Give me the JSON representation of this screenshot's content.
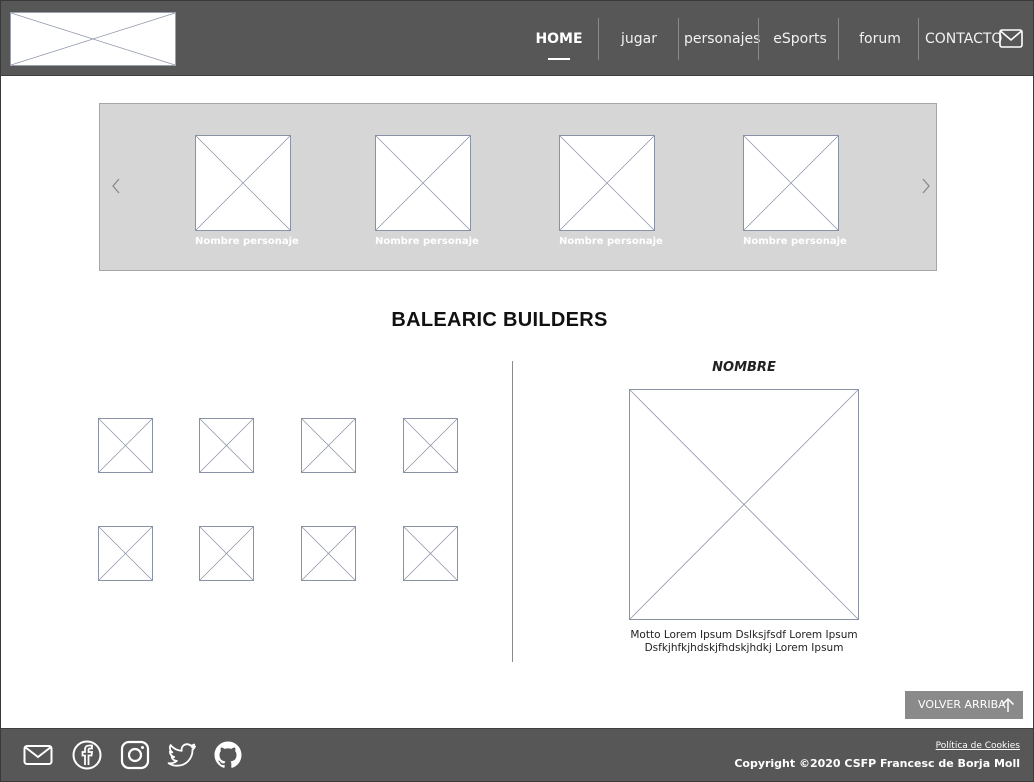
{
  "nav": {
    "items": [
      {
        "label": "HOME",
        "active": true
      },
      {
        "label": "jugar"
      },
      {
        "label": "personajes"
      },
      {
        "label": "eSports"
      },
      {
        "label": "forum"
      },
      {
        "label": "CONTACTO"
      }
    ],
    "contact_icon": "mail-icon"
  },
  "carousel": {
    "prev_icon": "chevron-left-icon",
    "next_icon": "chevron-right-icon",
    "characters": [
      {
        "name": "Nombre personaje"
      },
      {
        "name": "Nombre personaje"
      },
      {
        "name": "Nombre personaje"
      },
      {
        "name": "Nombre personaje"
      }
    ]
  },
  "section": {
    "title": "BALEARIC BUILDERS"
  },
  "detail": {
    "name": "NOMBRE",
    "motto_line1": "Motto Lorem Ipsum Dslksjfsdf Lorem Ipsum",
    "motto_line2": "Dsfkjhfkjhdskjfhdskjhdkj Lorem Ipsum"
  },
  "back_to_top": {
    "label": "VOLVER ARRIBA",
    "icon": "arrow-up-icon"
  },
  "footer": {
    "social_icons": [
      "mail-icon",
      "facebook-icon",
      "instagram-icon",
      "twitter-icon",
      "github-icon"
    ],
    "cookies_label": "Política de Cookies",
    "copyright": "Copyright ©2020 CSFP Francesc de Borja Moll"
  },
  "colors": {
    "header_bg": "#575757",
    "carousel_bg": "#d6d6d6",
    "placeholder_stroke": "#8a93a6",
    "button_bg": "#8a8a8a"
  }
}
